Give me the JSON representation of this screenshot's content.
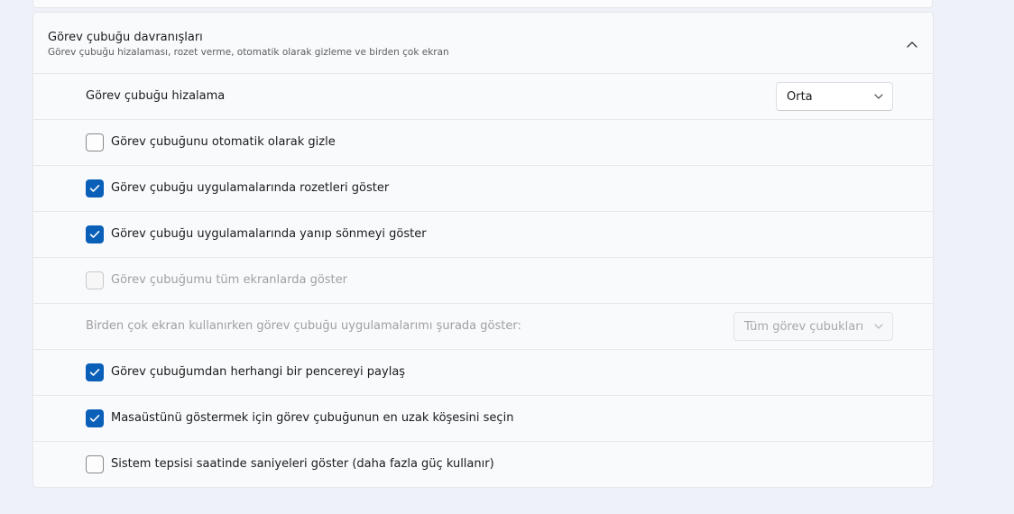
{
  "section": {
    "title": "Görev çubuğu davranışları",
    "subtitle": "Görev çubuğu hizalaması, rozet verme, otomatik olarak gizleme ve birden çok ekran",
    "expanded": true
  },
  "rows": {
    "alignment": {
      "label": "Görev çubuğu hizalama",
      "value": "Orta"
    },
    "auto_hide": {
      "label": "Görev çubuğunu otomatik olarak gizle",
      "checked": false
    },
    "badges": {
      "label": "Görev çubuğu uygulamalarında rozetleri göster",
      "checked": true
    },
    "flashing": {
      "label": "Görev çubuğu uygulamalarında yanıp sönmeyi göster",
      "checked": true
    },
    "all_displays": {
      "label": "Görev çubuğumu tüm ekranlarda göster",
      "checked": false,
      "disabled": true
    },
    "multi_display": {
      "label": "Birden çok ekran kullanırken görev çubuğu uygulamalarımı şurada göster:",
      "value": "Tüm görev çubukları",
      "disabled": true
    },
    "share_window": {
      "label": "Görev çubuğumdan herhangi bir pencereyi paylaş",
      "checked": true
    },
    "far_corner": {
      "label": "Masaüstünü göstermek için görev çubuğunun en uzak köşesini seçin",
      "checked": true
    },
    "seconds": {
      "label": "Sistem tepsisi saatinde saniyeleri göster (daha fazla güç kullanır)",
      "checked": false
    }
  },
  "colors": {
    "accent": "#0a5fb8",
    "background": "#eef2f8",
    "card": "#f9fafc",
    "disabled_text": "#a0a0a0"
  }
}
